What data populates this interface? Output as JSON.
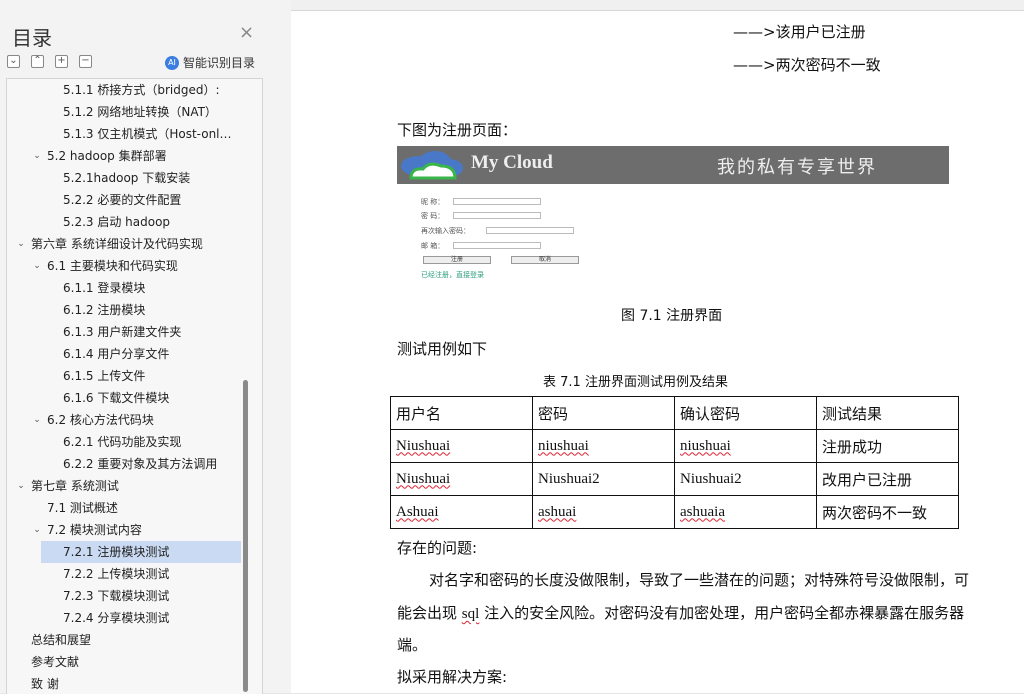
{
  "sidebar": {
    "title": "目录",
    "smart_toc_label": "智能识别目录",
    "items": [
      {
        "label": "5.1.1 桥接方式（bridged）:",
        "level": 3,
        "chevron": false
      },
      {
        "label": "5.1.2 网络地址转换（NAT）",
        "level": 3,
        "chevron": false
      },
      {
        "label": "5.1.3 仅主机模式（Host-onl…",
        "level": 3,
        "chevron": false
      },
      {
        "label": "5.2 hadoop 集群部署",
        "level": 2,
        "chevron": true
      },
      {
        "label": "5.2.1hadoop 下载安装",
        "level": 3,
        "chevron": false
      },
      {
        "label": "5.2.2 必要的文件配置",
        "level": 3,
        "chevron": false
      },
      {
        "label": "5.2.3 启动 hadoop",
        "level": 3,
        "chevron": false
      },
      {
        "label": "第六章 系统详细设计及代码实现",
        "level": 1,
        "chevron": true
      },
      {
        "label": "6.1 主要模块和代码实现",
        "level": 2,
        "chevron": true
      },
      {
        "label": "6.1.1 登录模块",
        "level": 3,
        "chevron": false
      },
      {
        "label": "6.1.2 注册模块",
        "level": 3,
        "chevron": false
      },
      {
        "label": "6.1.3 用户新建文件夹",
        "level": 3,
        "chevron": false
      },
      {
        "label": "6.1.4 用户分享文件",
        "level": 3,
        "chevron": false
      },
      {
        "label": "6.1.5 上传文件",
        "level": 3,
        "chevron": false
      },
      {
        "label": "6.1.6 下载文件模块",
        "level": 3,
        "chevron": false
      },
      {
        "label": "6.2 核心方法代码块",
        "level": 2,
        "chevron": true
      },
      {
        "label": "6.2.1 代码功能及实现",
        "level": 3,
        "chevron": false
      },
      {
        "label": "6.2.2 重要对象及其方法调用",
        "level": 3,
        "chevron": false
      },
      {
        "label": "第七章 系统测试",
        "level": 1,
        "chevron": true
      },
      {
        "label": "7.1 测试概述",
        "level": 2,
        "chevron": false
      },
      {
        "label": "7.2 模块测试内容",
        "level": 2,
        "chevron": true
      },
      {
        "label": "7.2.1 注册模块测试",
        "level": 3,
        "chevron": false,
        "active": true
      },
      {
        "label": "7.2.2 上传模块测试",
        "level": 3,
        "chevron": false
      },
      {
        "label": "7.2.3 下载模块测试",
        "level": 3,
        "chevron": false
      },
      {
        "label": "7.2.4 分享模块测试",
        "level": 3,
        "chevron": false
      },
      {
        "label": "总结和展望",
        "level": 1,
        "chevron": false
      },
      {
        "label": "参考文献",
        "level": 1,
        "chevron": false
      },
      {
        "label": "致  谢",
        "level": 1,
        "chevron": false
      }
    ]
  },
  "doc": {
    "line_registered": "——>该用户已注册",
    "line_mismatch": "——>两次密码不一致",
    "intro": "下图为注册页面：",
    "register_image": {
      "brand": "My Cloud",
      "slogan": "我的私有专享世界",
      "field_1": "昵 称：",
      "field_2": "密 码：",
      "field_3": "再次输入密码：",
      "field_4": "邮 箱：",
      "btn_register": "注册",
      "btn_cancel": "取消",
      "link": "已经注册，直接登录"
    },
    "figure_caption": "图 7.1 注册界面",
    "test_intro": "测试用例如下",
    "table_caption": "表 7.1 注册界面测试用例及结果",
    "table": {
      "headers": [
        "用户名",
        "密码",
        "确认密码",
        "测试结果"
      ],
      "rows": [
        [
          "Niushuai",
          "niushuai",
          "niushuai",
          "注册成功"
        ],
        [
          "Niushuai",
          "Niushuai2",
          "Niushuai2",
          "改用户已注册"
        ],
        [
          "Ashuai",
          "ashuai",
          "ashuaia",
          "两次密码不一致"
        ]
      ]
    },
    "problems_heading": "存在的问题:",
    "para_line1": "对名字和密码的长度没做限制，导致了一些潜在的问题；对特殊符号没做限制，可",
    "para_line2_pre": "能会出现 ",
    "para_line2_sql": "sql",
    "para_line2_post": " 注入的安全风险。对密码没有加密处理，用户密码全都赤裸暴露在服务器",
    "para_line3": "端。",
    "solution_heading": "拟采用解决方案:"
  }
}
